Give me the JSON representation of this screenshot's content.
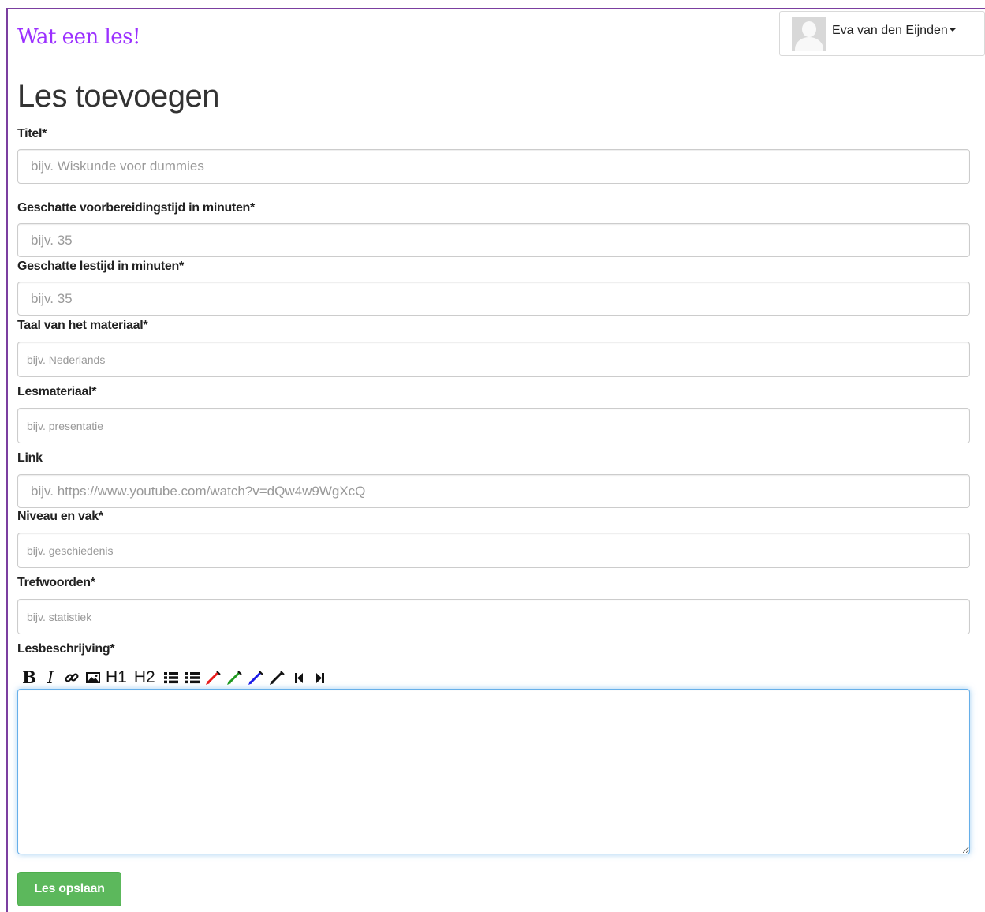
{
  "app": {
    "brand": "Wat een les!"
  },
  "user": {
    "name": "Eva van den Eijnden"
  },
  "page": {
    "title": "Les toevoegen"
  },
  "form": {
    "titel": {
      "label": "Titel*",
      "placeholder": "bijv. Wiskunde voor dummies"
    },
    "voorbereidingstijd": {
      "label": "Geschatte voorbereidingstijd in minuten*",
      "placeholder": "bijv. 35"
    },
    "lestijd": {
      "label": "Geschatte lestijd in minuten*",
      "placeholder": "bijv. 35"
    },
    "taal": {
      "label": "Taal van het materiaal*",
      "placeholder": "bijv. Nederlands"
    },
    "lesmateriaal": {
      "label": "Lesmateriaal*",
      "placeholder": "bijv. presentatie"
    },
    "link": {
      "label": "Link",
      "placeholder": "bijv. https://www.youtube.com/watch?v=dQw4w9WgXcQ"
    },
    "niveau": {
      "label": "Niveau en vak*",
      "placeholder": "bijv. geschiedenis"
    },
    "trefwoorden": {
      "label": "Trefwoorden*",
      "placeholder": "bijv. statistiek"
    },
    "beschrijving": {
      "label": "Lesbeschrijving*"
    },
    "submit_label": "Les opslaan"
  },
  "toolbar": {
    "bold": "B",
    "italic": "I",
    "h1": "H1",
    "h2": "H2",
    "icons": [
      "bold-icon",
      "italic-icon",
      "link-icon",
      "image-icon",
      "bullet-list-icon",
      "numbered-list-icon",
      "pen-red-icon",
      "pen-green-icon",
      "pen-blue-icon",
      "pen-black-icon",
      "step-backward-icon",
      "step-forward-icon"
    ],
    "pen_colors": {
      "red": "#e81a1a",
      "green": "#1f9a1f",
      "blue": "#1a1ae8",
      "black": "#111111"
    }
  },
  "colors": {
    "brand": "#9b30ff",
    "frame": "#7b3fa0",
    "save_button": "#5cb85c",
    "focus_border": "#66afe9"
  }
}
